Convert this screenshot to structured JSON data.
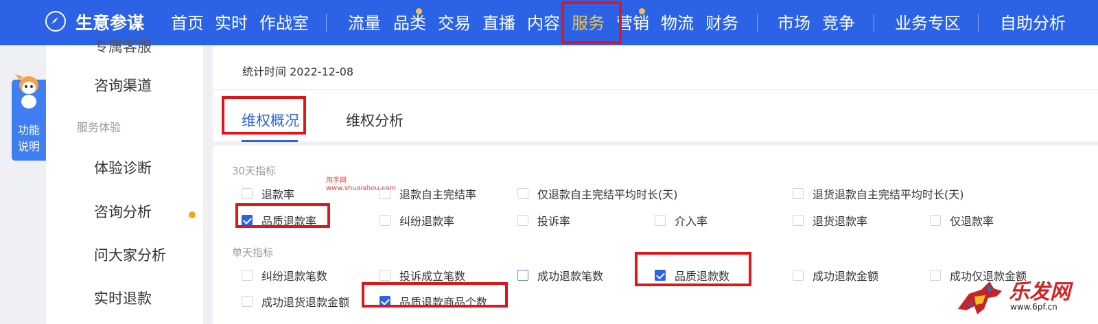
{
  "brand": {
    "name": "生意参谋"
  },
  "nav": {
    "items": [
      "首页",
      "实时",
      "作战室",
      "流量",
      "品类",
      "交易",
      "直播",
      "内容",
      "服务",
      "营销",
      "物流",
      "财务",
      "市场",
      "竞争",
      "业务专区",
      "自助分析"
    ],
    "active": "服务"
  },
  "helper": {
    "label": "功能说明"
  },
  "sidebar": {
    "partial_top": "专属客服",
    "items": [
      "咨询渠道"
    ],
    "group": "服务体验",
    "group_items": [
      "体验诊断",
      "咨询分析",
      "问大家分析",
      "实时退款"
    ]
  },
  "header": {
    "stat_time": "统计时间 2022-12-08",
    "tabs": [
      "维权概况",
      "维权分析"
    ],
    "active_tab": "维权概况"
  },
  "metrics30": {
    "title": "30天指标",
    "items": [
      {
        "label": "退款率",
        "checked": false
      },
      {
        "label": "退款自主完结率",
        "checked": false
      },
      {
        "label": "仅退款自主完结平均时长(天)",
        "checked": false
      },
      {
        "label": "退货退款自主完结平均时长(天)",
        "checked": false
      },
      {
        "label": "品质退款率",
        "checked": true
      },
      {
        "label": "纠纷退款率",
        "checked": false
      },
      {
        "label": "投诉率",
        "checked": false
      },
      {
        "label": "介入率",
        "checked": false
      },
      {
        "label": "退货退款率",
        "checked": false
      },
      {
        "label": "仅退款率",
        "checked": false
      }
    ]
  },
  "metrics1d": {
    "title": "单天指标",
    "items": [
      {
        "label": "纠纷退款笔数",
        "checked": false
      },
      {
        "label": "投诉成立笔数",
        "checked": false
      },
      {
        "label": "成功退款笔数",
        "checked": false
      },
      {
        "label": "品质退款数",
        "checked": true
      },
      {
        "label": "成功退款金额",
        "checked": false
      },
      {
        "label": "成功仅退款金额",
        "checked": false
      },
      {
        "label": "成功退货退款金额",
        "checked": false
      },
      {
        "label": "品质退款商品个数",
        "checked": true
      }
    ]
  },
  "watermark": {
    "line1": "甩手网",
    "line2": "www.shuaishou.com"
  },
  "corner": {
    "name": "乐发网",
    "url": "www.6pf.cn"
  },
  "colors": {
    "nav_bg": "#2c63e6",
    "accent": "#2c63e6",
    "active_nav": "#f3c43a",
    "highlight": "#e0161b"
  }
}
